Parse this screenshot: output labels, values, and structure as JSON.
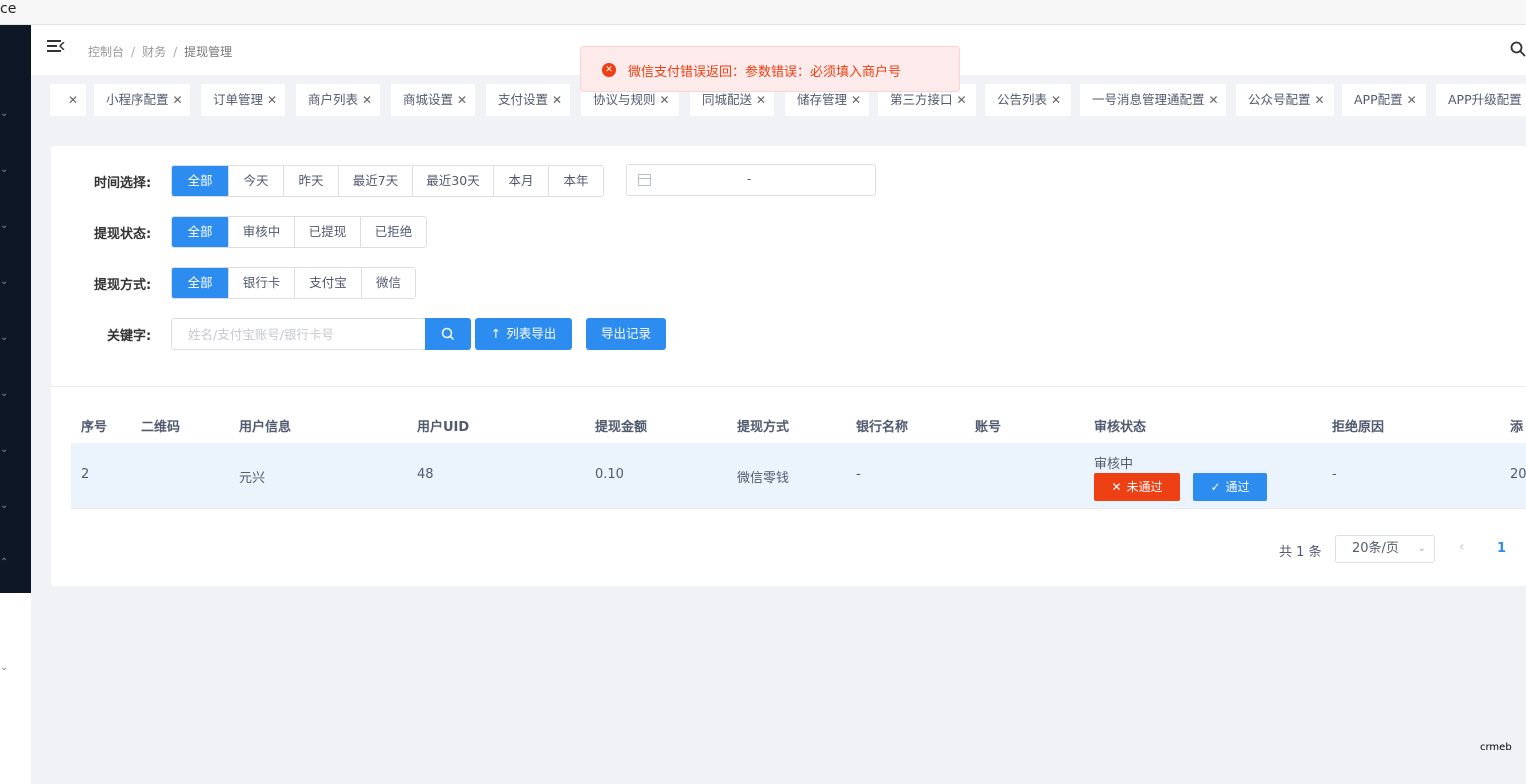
{
  "window": {
    "title_fragment": "ce"
  },
  "header": {
    "breadcrumb": [
      "控制台",
      "财务",
      "提现管理"
    ]
  },
  "toast": {
    "message": "微信支付错误返回：参数错误：必须填入商户号"
  },
  "tabs": [
    {
      "label": ""
    },
    {
      "label": "小程序配置"
    },
    {
      "label": "订单管理"
    },
    {
      "label": "商户列表"
    },
    {
      "label": "商城设置"
    },
    {
      "label": "支付设置"
    },
    {
      "label": "协议与规则"
    },
    {
      "label": "同城配送"
    },
    {
      "label": "储存管理"
    },
    {
      "label": "第三方接口"
    },
    {
      "label": "公告列表"
    },
    {
      "label": "一号消息管理通配置"
    },
    {
      "label": "公众号配置"
    },
    {
      "label": "APP配置"
    },
    {
      "label": "APP升级配置"
    }
  ],
  "filters": {
    "time": {
      "label": "时间选择:",
      "options": [
        "全部",
        "今天",
        "昨天",
        "最近7天",
        "最近30天",
        "本月",
        "本年"
      ],
      "selected": "全部"
    },
    "date_range": {
      "separator": "-"
    },
    "status": {
      "label": "提现状态:",
      "options": [
        "全部",
        "审核中",
        "已提现",
        "已拒绝"
      ],
      "selected": "全部"
    },
    "method": {
      "label": "提现方式:",
      "options": [
        "全部",
        "银行卡",
        "支付宝",
        "微信"
      ],
      "selected": "全部"
    },
    "keyword": {
      "label": "关键字:",
      "placeholder": "姓名/支付宝账号/银行卡号",
      "value": ""
    }
  },
  "actions": {
    "export_list": "列表导出",
    "export_records": "导出记录"
  },
  "table": {
    "columns": [
      "序号",
      "二维码",
      "用户信息",
      "用户UID",
      "提现金额",
      "提现方式",
      "银行名称",
      "账号",
      "审核状态",
      "拒绝原因",
      "添"
    ],
    "rows": [
      {
        "id": "2",
        "qrcode": "",
        "user": "元兴",
        "uid": "48",
        "amount": "0.10",
        "method": "微信零钱",
        "bank": "-",
        "account": "",
        "status": "审核中",
        "reject_btn": "未通过",
        "approve_btn": "通过",
        "reason": "-",
        "added": "20"
      }
    ]
  },
  "pagination": {
    "total": "共 1 条",
    "page_size": "20条/页",
    "current": "1"
  },
  "watermark": "crmeb",
  "colors": {
    "primary": "#2d8cf0",
    "danger": "#ed4014",
    "sidebar": "#0d1726",
    "row_highlight": "#ebf4fd"
  }
}
